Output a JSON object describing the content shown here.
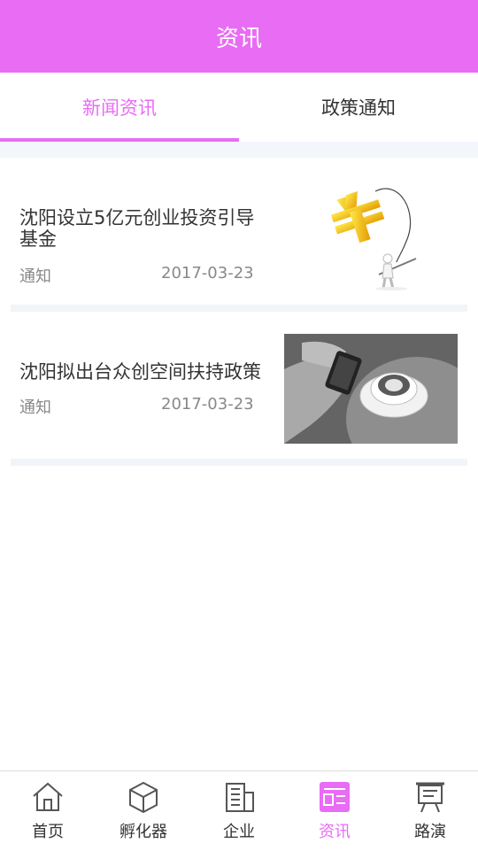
{
  "header": {
    "title": "资讯"
  },
  "tabs": [
    {
      "label": "新闻资讯"
    },
    {
      "label": "政策通知"
    }
  ],
  "articles": [
    {
      "title": "沈阳设立5亿元创业投资引导基金",
      "source": "通知",
      "date": "2017-03-23",
      "thumb_icon": "yuan-fishing-icon"
    },
    {
      "title": "沈阳拟出台众创空间扶持政策",
      "source": "通知",
      "date": "2017-03-23",
      "thumb_icon": "coffee-phone-icon"
    }
  ],
  "tabbar": [
    {
      "label": "首页",
      "icon": "home-icon"
    },
    {
      "label": "孵化器",
      "icon": "cube-icon"
    },
    {
      "label": "企业",
      "icon": "building-icon"
    },
    {
      "label": "资讯",
      "icon": "news-icon"
    },
    {
      "label": "路演",
      "icon": "presentation-icon"
    }
  ],
  "colors": {
    "accent": "#E96CF5",
    "divider": "#F3F7FC"
  }
}
